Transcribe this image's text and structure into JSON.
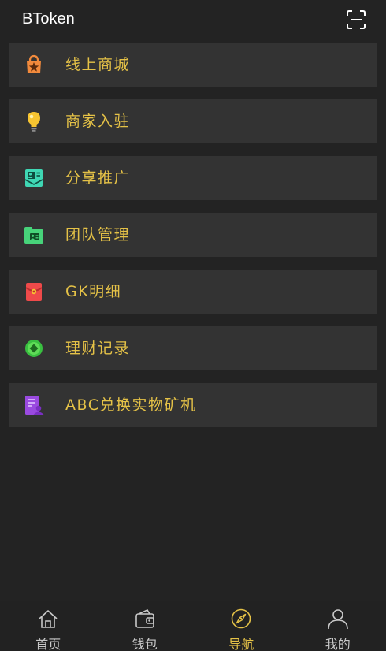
{
  "app": {
    "title": "BToken"
  },
  "header": {
    "scan_icon": "scan-icon"
  },
  "menu": {
    "items": [
      {
        "label": "线上商城",
        "icon": "shopping-bag-icon",
        "color": "#f28a3c"
      },
      {
        "label": "商家入驻",
        "icon": "lightbulb-icon",
        "color": "#f7c531"
      },
      {
        "label": "分享推广",
        "icon": "share-mail-icon",
        "color": "#3fd7b4"
      },
      {
        "label": "团队管理",
        "icon": "team-folder-icon",
        "color": "#47d37a"
      },
      {
        "label": "GK明细",
        "icon": "red-envelope-icon",
        "color": "#ef4a4a"
      },
      {
        "label": "理财记录",
        "icon": "coin-icon",
        "color": "#39c040"
      },
      {
        "label": "ABC兑换实物矿机",
        "icon": "document-user-icon",
        "color": "#9a4ae0"
      }
    ]
  },
  "tabbar": {
    "tabs": [
      {
        "label": "首页",
        "icon": "home-icon",
        "active": false
      },
      {
        "label": "钱包",
        "icon": "wallet-icon",
        "active": false
      },
      {
        "label": "导航",
        "icon": "compass-icon",
        "active": true
      },
      {
        "label": "我的",
        "icon": "user-icon",
        "active": false
      }
    ],
    "active_color": "#e5c247",
    "inactive_color": "#c9c9c9"
  }
}
